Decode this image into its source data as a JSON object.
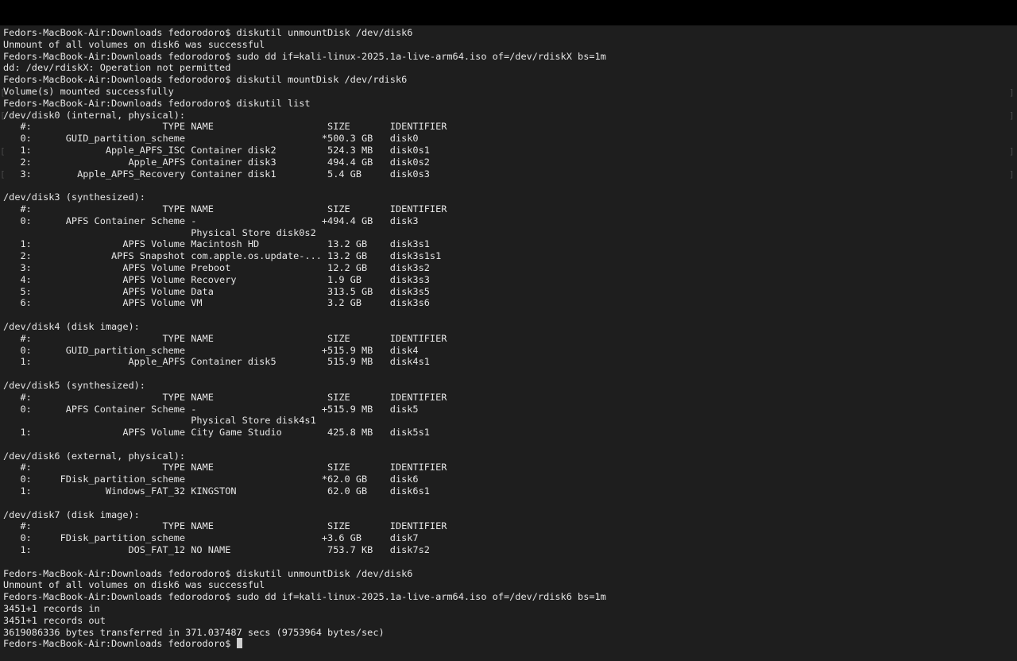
{
  "terminal": {
    "prompt": "Fedors-MacBook-Air:Downloads fedorodoro$ ",
    "lines": [
      "Fedors-MacBook-Air:Downloads fedorodoro$ diskutil unmountDisk /dev/disk6",
      "Unmount of all volumes on disk6 was successful",
      "Fedors-MacBook-Air:Downloads fedorodoro$ sudo dd if=kali-linux-2025.1a-live-arm64.iso of=/dev/rdiskX bs=1m",
      "dd: /dev/rdiskX: Operation not permitted",
      "Fedors-MacBook-Air:Downloads fedorodoro$ diskutil mountDisk /dev/rdisk6",
      "Volume(s) mounted successfully",
      "Fedors-MacBook-Air:Downloads fedorodoro$ diskutil list",
      "/dev/disk0 (internal, physical):",
      "   #:                       TYPE NAME                    SIZE       IDENTIFIER",
      "   0:      GUID_partition_scheme                        *500.3 GB   disk0",
      "   1:             Apple_APFS_ISC Container disk2         524.3 MB   disk0s1",
      "   2:                 Apple_APFS Container disk3         494.4 GB   disk0s2",
      "   3:        Apple_APFS_Recovery Container disk1         5.4 GB     disk0s3",
      "",
      "/dev/disk3 (synthesized):",
      "   #:                       TYPE NAME                    SIZE       IDENTIFIER",
      "   0:      APFS Container Scheme -                      +494.4 GB   disk3",
      "                                 Physical Store disk0s2",
      "   1:                APFS Volume Macintosh HD            13.2 GB    disk3s1",
      "   2:              APFS Snapshot com.apple.os.update-... 13.2 GB    disk3s1s1",
      "   3:                APFS Volume Preboot                 12.2 GB    disk3s2",
      "   4:                APFS Volume Recovery                1.9 GB     disk3s3",
      "   5:                APFS Volume Data                    313.5 GB   disk3s5",
      "   6:                APFS Volume VM                      3.2 GB     disk3s6",
      "",
      "/dev/disk4 (disk image):",
      "   #:                       TYPE NAME                    SIZE       IDENTIFIER",
      "   0:      GUID_partition_scheme                        +515.9 MB   disk4",
      "   1:                 Apple_APFS Container disk5         515.9 MB   disk4s1",
      "",
      "/dev/disk5 (synthesized):",
      "   #:                       TYPE NAME                    SIZE       IDENTIFIER",
      "   0:      APFS Container Scheme -                      +515.9 MB   disk5",
      "                                 Physical Store disk4s1",
      "   1:                APFS Volume City Game Studio        425.8 MB   disk5s1",
      "",
      "/dev/disk6 (external, physical):",
      "   #:                       TYPE NAME                    SIZE       IDENTIFIER",
      "   0:     FDisk_partition_scheme                        *62.0 GB    disk6",
      "   1:             Windows_FAT_32 KINGSTON                62.0 GB    disk6s1",
      "",
      "/dev/disk7 (disk image):",
      "   #:                       TYPE NAME                    SIZE       IDENTIFIER",
      "   0:     FDisk_partition_scheme                        +3.6 GB     disk7",
      "   1:                 DOS_FAT_12 NO NAME                 753.7 KB   disk7s2",
      "",
      "Fedors-MacBook-Air:Downloads fedorodoro$ diskutil unmountDisk /dev/disk6",
      "Unmount of all volumes on disk6 was successful",
      "Fedors-MacBook-Air:Downloads fedorodoro$ sudo dd if=kali-linux-2025.1a-live-arm64.iso of=/dev/rdisk6 bs=1m",
      "3451+1 records in",
      "3451+1 records out",
      "3619086336 bytes transferred in 371.037487 secs (9753964 bytes/sec)"
    ]
  },
  "colors": {
    "background": "#1e1e1e",
    "titlebar": "#000000",
    "text": "#e6e6e6",
    "cursor": "#d0d0d0"
  }
}
